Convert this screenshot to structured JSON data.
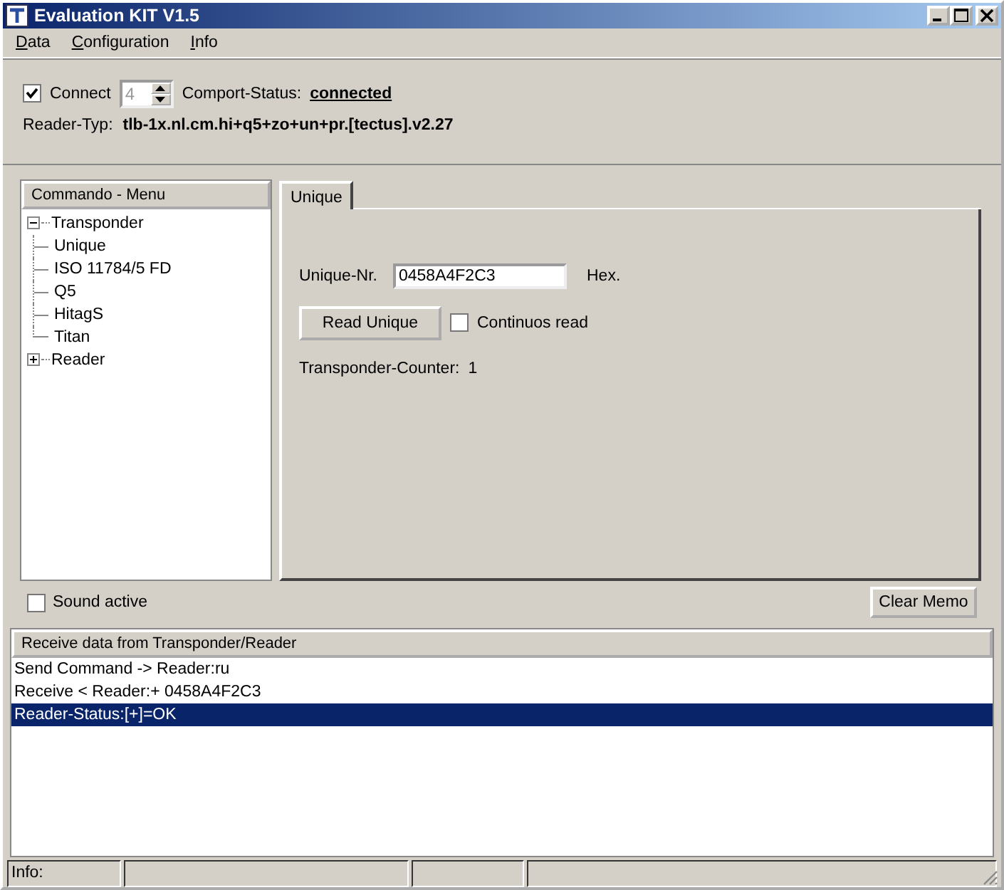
{
  "window": {
    "title": "Evaluation KIT V1.5"
  },
  "menu": [
    "Data",
    "Configuration",
    "Info"
  ],
  "connection": {
    "connect_label": "Connect",
    "connect_checked": true,
    "port_value": "4",
    "status_label": "Comport-Status:",
    "status_value": "connected",
    "reader_label": "Reader-Typ:",
    "reader_value": "tlb-1x.nl.cm.hi+q5+zo+un+pr.[tectus].v2.27"
  },
  "commando_menu": {
    "title": "Commando - Menu",
    "items": [
      {
        "label": "Transponder",
        "expanded": true,
        "children": [
          {
            "label": "Unique"
          },
          {
            "label": "ISO 11784/5 FD"
          },
          {
            "label": "Q5"
          },
          {
            "label": "HitagS"
          },
          {
            "label": "Titan"
          }
        ]
      },
      {
        "label": "Reader",
        "expanded": false
      }
    ]
  },
  "tabs": [
    {
      "label": "Unique",
      "selected": true
    }
  ],
  "unique_panel": {
    "nr_label": "Unique-Nr.",
    "nr_value": "0458A4F2C3",
    "unit": "Hex.",
    "read_button": "Read Unique",
    "continuous_label": "Continuos read",
    "continuous_checked": false,
    "counter_label": "Transponder-Counter:",
    "counter_value": "1"
  },
  "sound": {
    "label": "Sound active",
    "checked": false
  },
  "clear_button": "Clear Memo",
  "log": {
    "title": "Receive data from Transponder/Reader",
    "lines": [
      {
        "text": "Send Command -> Reader:ru",
        "selected": false
      },
      {
        "text": "Receive < Reader:+ 0458A4F2C3",
        "selected": false
      },
      {
        "text": "Reader-Status:[+]=OK",
        "selected": true
      }
    ]
  },
  "status_bar": {
    "info": "Info:"
  }
}
